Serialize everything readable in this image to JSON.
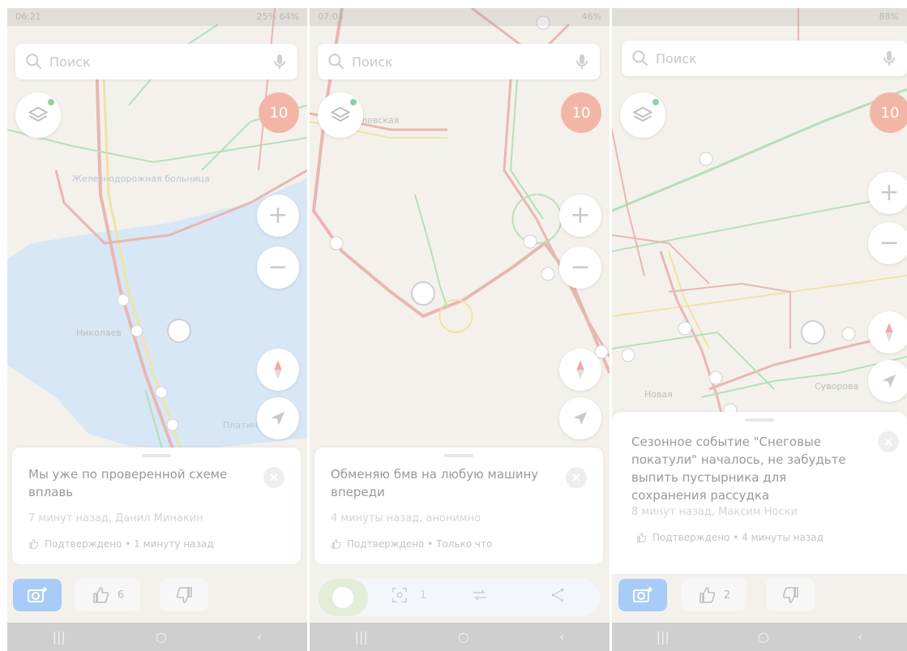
{
  "colors": {
    "map_bg": "#f4f1ec",
    "water": "#d7e7f5",
    "road_major": "#e8b7b2",
    "road_green": "#b6dfb8",
    "road_yellow": "#efe3a6",
    "camera_button": "#a8ccf7",
    "traffic_badge": "#f3b6a6",
    "navbar": "#cfcfcf"
  },
  "panels": [
    {
      "status": {
        "time": "06:21",
        "right": "25% 64%"
      },
      "search": {
        "placeholder": "Поиск"
      },
      "traffic_level": "10",
      "map_labels": {
        "hospital": "Железнодорожная больница",
        "nikolaev": "Николаев",
        "platin": "Платин"
      },
      "card": {
        "title": "Мы уже по проверенной схеме вплавь",
        "meta": "7 минут назад, Данил Минакин",
        "confirm": "Подтверждено • 1 минуту назад"
      },
      "actions": {
        "like_count": "6"
      }
    },
    {
      "status": {
        "time": "07:03",
        "right": "46%"
      },
      "search": {
        "placeholder": "Поиск"
      },
      "traffic_level": "10",
      "map_labels": {
        "street": "левская"
      },
      "card": {
        "title": "Обменяю бмв  на любую машину впереди",
        "meta": "4 минуты назад, анонимно",
        "confirm": "Подтверждено • Только что"
      },
      "actions": {
        "count": "1"
      }
    },
    {
      "status": {
        "time": "",
        "right": "88%"
      },
      "search": {
        "placeholder": "Поиск"
      },
      "traffic_level": "10",
      "map_labels": {
        "novaya": "Новая",
        "suvorova": "Суворова"
      },
      "card": {
        "title": "Сезонное событие \"Снеговые покатули\" началось, не забудьте выпить пустырника для сохранения рассудка",
        "meta": "8 минут назад, Максим Носки",
        "confirm": "Подтверждено • 4 минуты назад"
      },
      "actions": {
        "like_count": "2"
      }
    }
  ],
  "navbar": {
    "recents": "|||",
    "home": "○",
    "back": "‹"
  }
}
